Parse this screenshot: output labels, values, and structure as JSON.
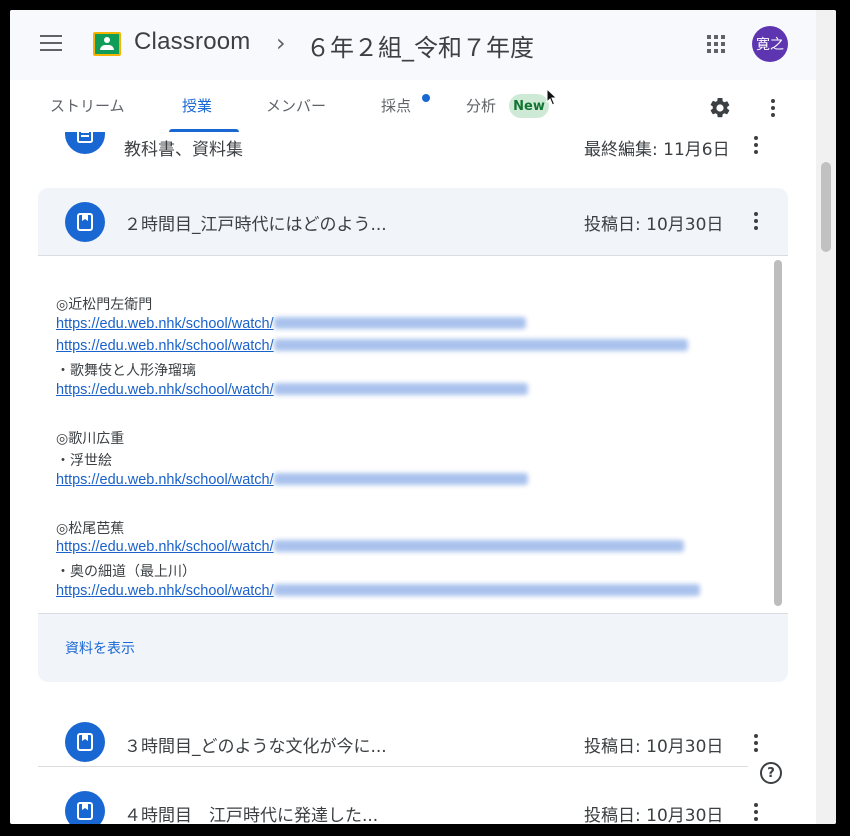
{
  "header": {
    "app_name": "Classroom",
    "breadcrumb_sep": "›",
    "class_name": "６年２組_令和７年度",
    "avatar_text": "寛之"
  },
  "tabs": {
    "stream": "ストリーム",
    "classwork": "授業",
    "people": "メンバー",
    "grades": "採点",
    "analytics": "分析",
    "new_badge": "New"
  },
  "colors": {
    "accent": "#1967d2",
    "header_bg": "#f8f9fd",
    "card_bg": "#f1f4f9",
    "avatar": "#5e35b1",
    "badge_bg": "#ceead6"
  },
  "icons": [
    "menu-icon",
    "classroom-logo-icon",
    "apps-icon",
    "gear-icon",
    "more-vert-icon",
    "material-icon",
    "assignment-icon",
    "help-icon"
  ],
  "rows": {
    "prev": {
      "title": "教科書、資料集",
      "date": "最終編集: 11月6日"
    },
    "expanded": {
      "title": "２時間目_江戸時代にはどのよう...",
      "date": "投稿日: 10月30日",
      "lines": {
        "h1": "◎近松門左衛門",
        "l1": "https://edu.web.nhk/school/watch/",
        "l2": "https://edu.web.nhk/school/watch/",
        "b1": "・歌舞伎と人形浄瑠璃",
        "l3": "https://edu.web.nhk/school/watch/",
        "h2": "◎歌川広重",
        "b2": "・浮世絵",
        "l4": "https://edu.web.nhk/school/watch/",
        "h3": "◎松尾芭蕉",
        "l5": "https://edu.web.nhk/school/watch/",
        "b3": "・奥の細道（最上川）",
        "l6": "https://edu.web.nhk/school/watch/"
      },
      "show_materials": "資料を表示"
    },
    "row3": {
      "title": "３時間目_どのような文化が今に...",
      "date": "投稿日: 10月30日"
    },
    "row4": {
      "title": "４時間目　江戸時代に発達した...",
      "date": "投稿日: 10月30日"
    }
  },
  "help": "?"
}
